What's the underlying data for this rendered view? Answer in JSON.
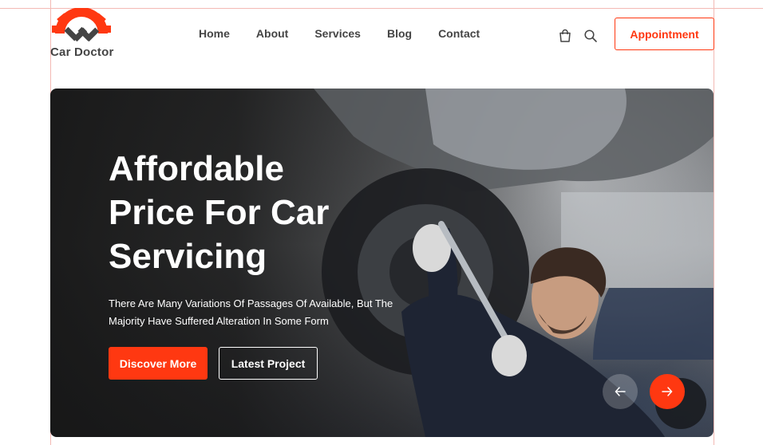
{
  "brand": {
    "name": "Car Doctor",
    "accent_color": "#FF3811",
    "text_color": "#444444"
  },
  "nav": {
    "items": [
      {
        "label": "Home"
      },
      {
        "label": "About"
      },
      {
        "label": "Services"
      },
      {
        "label": "Blog"
      },
      {
        "label": "Contact"
      }
    ]
  },
  "header": {
    "icons": [
      "shopping-bag-icon",
      "search-icon"
    ],
    "cta_label": "Appointment"
  },
  "hero": {
    "title": "Affordable Price For Car Servicing",
    "description": "There Are Many Variations Of Passages Of  Available, But The Majority Have Suffered Alteration In Some Form",
    "primary_button": "Discover More",
    "secondary_button": "Latest Project",
    "prev_icon": "arrow-left-icon",
    "next_icon": "arrow-right-icon"
  }
}
